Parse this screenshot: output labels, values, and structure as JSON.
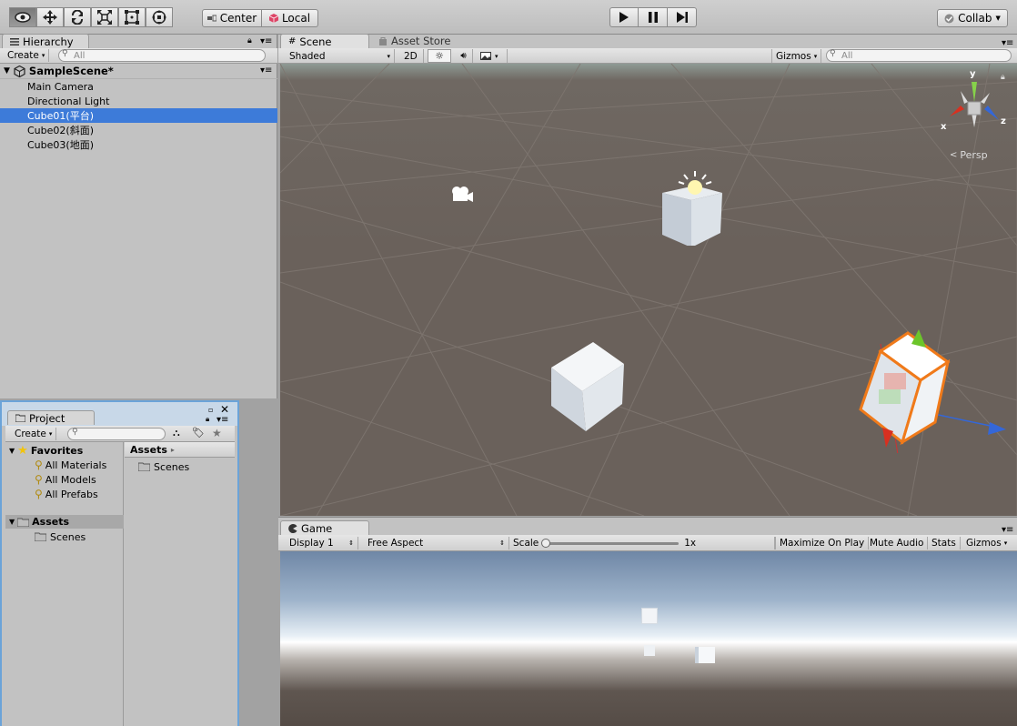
{
  "toolbar": {
    "tools": [
      "view-tool",
      "move-tool",
      "rotate-tool",
      "scale-tool",
      "rect-tool",
      "transform-tool"
    ],
    "center_label": "Center",
    "local_label": "Local",
    "collab_label": "Collab"
  },
  "hierarchy": {
    "tab_label": "Hierarchy",
    "create_label": "Create",
    "search_placeholder": "All",
    "scene_name": "SampleScene*",
    "items": [
      "Main Camera",
      "Directional Light",
      "Cube01(平台)",
      "Cube02(斜面)",
      "Cube03(地面)"
    ],
    "selected_index": 2
  },
  "project": {
    "tab_label": "Project",
    "create_label": "Create",
    "favorites_label": "Favorites",
    "favorites": [
      "All Materials",
      "All Models",
      "All Prefabs"
    ],
    "assets_label": "Assets",
    "asset_children": [
      "Scenes"
    ],
    "breadcrumb": "Assets",
    "folder_items": [
      "Scenes"
    ]
  },
  "scene": {
    "tab_label": "Scene",
    "asset_store_label": "Asset Store",
    "shading": "Shaded",
    "mode_2d": "2D",
    "gizmos_label": "Gizmos",
    "search_placeholder": "All",
    "projection": "Persp",
    "axis_x": "x",
    "axis_y": "y",
    "axis_z": "z"
  },
  "game": {
    "tab_label": "Game",
    "display": "Display 1",
    "aspect": "Free Aspect",
    "scale_label": "Scale",
    "scale_value": "1x",
    "maximize": "Maximize On Play",
    "mute": "Mute Audio",
    "stats": "Stats",
    "gizmos_label": "Gizmos"
  },
  "colors": {
    "selection": "#3d7bd9",
    "scene_bg": "#6a615b",
    "accent_orange": "#f07a1a"
  }
}
